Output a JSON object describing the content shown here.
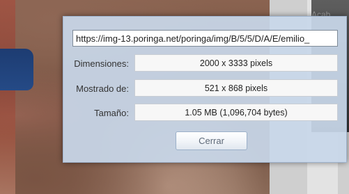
{
  "background": {
    "right_panel_text": "Acab"
  },
  "dialog": {
    "url": "https://img-13.poringa.net/poringa/img/B/5/5/D/A/E/emilio_",
    "rows": [
      {
        "label": "Dimensiones:",
        "value": "2000 x 3333 pixels"
      },
      {
        "label": "Mostrado de:",
        "value": "521 x 868 pixels"
      },
      {
        "label": "Tamaño:",
        "value": "1.05 MB (1,096,704 bytes)"
      }
    ],
    "close_label": "Cerrar"
  }
}
